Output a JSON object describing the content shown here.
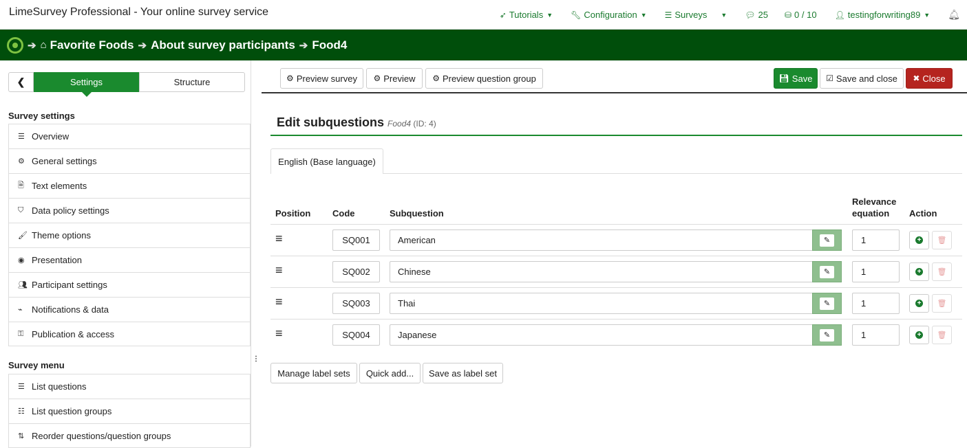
{
  "app": {
    "title": "LimeSurvey Professional - Your online survey service"
  },
  "topnav": {
    "tutorials": "Tutorials",
    "configuration": "Configuration",
    "surveys": "Surveys",
    "notifications_count": "25",
    "storage": "0 / 10",
    "user": "testingforwriting89"
  },
  "breadcrumb": {
    "survey": "Favorite Foods",
    "group": "About survey participants",
    "question": "Food4"
  },
  "sidebar": {
    "back_icon": "chevron-left-icon",
    "tab_settings": "Settings",
    "tab_structure": "Structure",
    "survey_settings_title": "Survey settings",
    "settings_items": [
      {
        "label": "Overview",
        "icon": "list-icon"
      },
      {
        "label": "General settings",
        "icon": "gears-icon"
      },
      {
        "label": "Text elements",
        "icon": "file-text-icon"
      },
      {
        "label": "Data policy settings",
        "icon": "shield-icon"
      },
      {
        "label": "Theme options",
        "icon": "paintbrush-icon"
      },
      {
        "label": "Presentation",
        "icon": "eye-slash-icon"
      },
      {
        "label": "Participant settings",
        "icon": "users-icon"
      },
      {
        "label": "Notifications & data",
        "icon": "feed-icon"
      },
      {
        "label": "Publication & access",
        "icon": "key-icon"
      }
    ],
    "survey_menu_title": "Survey menu",
    "menu_items": [
      {
        "label": "List questions",
        "icon": "list-icon"
      },
      {
        "label": "List question groups",
        "icon": "th-list-icon"
      },
      {
        "label": "Reorder questions/question groups",
        "icon": "reorder-icon"
      }
    ]
  },
  "toolbar": {
    "preview_survey": "Preview survey",
    "preview": "Preview",
    "preview_group": "Preview question group",
    "save": "Save",
    "save_close": "Save and close",
    "close": "Close"
  },
  "page": {
    "heading": "Edit subquestions",
    "question_code": "Food4",
    "question_id": "(ID: 4)",
    "language_tab": "English (Base language)"
  },
  "table": {
    "headers": {
      "position": "Position",
      "code": "Code",
      "subquestion": "Subquestion",
      "relevance_line1": "Relevance",
      "relevance_line2": "equation",
      "action": "Action"
    },
    "rows": [
      {
        "code": "SQ001",
        "subquestion": "American",
        "relevance": "1"
      },
      {
        "code": "SQ002",
        "subquestion": "Chinese",
        "relevance": "1"
      },
      {
        "code": "SQ003",
        "subquestion": "Thai",
        "relevance": "1"
      },
      {
        "code": "SQ004",
        "subquestion": "Japanese",
        "relevance": "1"
      }
    ]
  },
  "bottom_buttons": {
    "manage_label_sets": "Manage label sets",
    "quick_add": "Quick add...",
    "save_as_label_set": "Save as label set"
  },
  "colors": {
    "brand_green": "#1a8a2e",
    "dark_green": "#004e0b",
    "danger": "#b5241f"
  }
}
